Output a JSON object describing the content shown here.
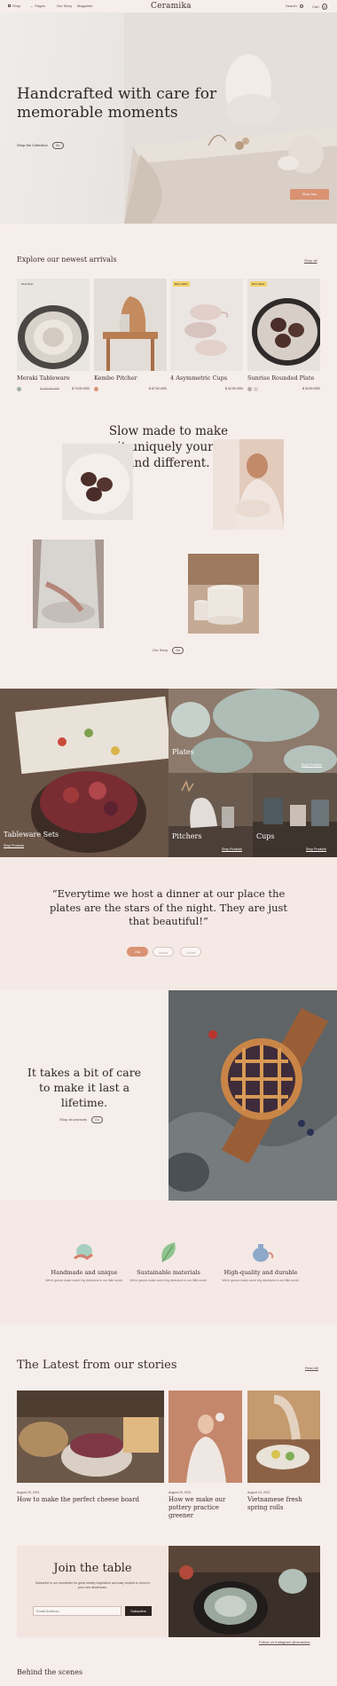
{
  "nav": {
    "shop": "Shop",
    "pages": "Pages",
    "our_story": "Our Story",
    "magazine": "Magazine",
    "logo": "Ceramika",
    "search": "Search",
    "cart": "Cart",
    "cart_count": "0"
  },
  "hero": {
    "title": "Handcrafted with care for memorable moments",
    "shop_label": "Shop the Collection",
    "shop_pill": "Go",
    "button": "Shop Now"
  },
  "arrivals": {
    "title": "Explore our newest arrivals",
    "shop_all": "Shop all",
    "products": [
      {
        "name": "Meraki Tableware",
        "badge": "New Drop",
        "old_price": "$ 100.00 USD",
        "price": "$ 74.00 USD"
      },
      {
        "name": "Kembo Pitcher",
        "badge": "",
        "old_price": "",
        "price": "$ 67.00 USD"
      },
      {
        "name": "4 Asymmetric Cups",
        "badge": "Best Seller",
        "old_price": "",
        "price": "$ 42.00 USD"
      },
      {
        "name": "Sunrise Rounded Plate",
        "badge": "Best Seller",
        "old_price": "",
        "price": "$ 34.00 USD"
      }
    ]
  },
  "slow": {
    "title": "Slow made to make it uniquely yours and different.",
    "link": "Our Story",
    "pill": "Go"
  },
  "categories": {
    "items": [
      {
        "name": "Tableware Sets",
        "sub": "Shop Products"
      },
      {
        "name": "Plates",
        "sub": "Shop Products"
      },
      {
        "name": "Pitchers",
        "sub": "Shop Products"
      },
      {
        "name": "Cups",
        "sub": "Shop Products"
      }
    ]
  },
  "review": {
    "quote": "“Everytime we host a dinner at our place the plates are the stars of the night. They are just that beautiful!”",
    "buttons": [
      "Ola",
      "Maria",
      "Daniel"
    ]
  },
  "care": {
    "title": "It takes a bit of care to make it last a lifetime.",
    "link": "Shop all products",
    "pill": "Go"
  },
  "features": [
    {
      "title": "Handmade and unique",
      "desc": "We're gonna make some big decisions in our little world."
    },
    {
      "title": "Sustainable materials",
      "desc": "We're gonna make some big decisions in our little world."
    },
    {
      "title": "High-quality and durable",
      "desc": "We're gonna make some big decisions in our little world."
    }
  ],
  "stories": {
    "title": "The Latest from our stories",
    "read_all": "Read All",
    "items": [
      {
        "date": "August 29, 2021",
        "title": "How to make the perfect cheese board"
      },
      {
        "date": "August 29, 2021",
        "title": "How we make our pottery practice greener"
      },
      {
        "date": "August 13, 2021",
        "title": "Vietnamese fresh spring rolls"
      }
    ]
  },
  "newsletter": {
    "title": "Join the table",
    "desc": "Subscribe to our newsletter for great weekly inspiration and easy recipes to serve in your new dinnerware.",
    "placeholder": "Email Address",
    "button": "Subscribe",
    "instagram": "Follow on Instagram @ceramika"
  },
  "footer_teaser": {
    "title": "Behind the scenes"
  },
  "colors": {
    "background": "#f6eeeb",
    "accent": "#d99272",
    "text": "#3b2f2b"
  }
}
